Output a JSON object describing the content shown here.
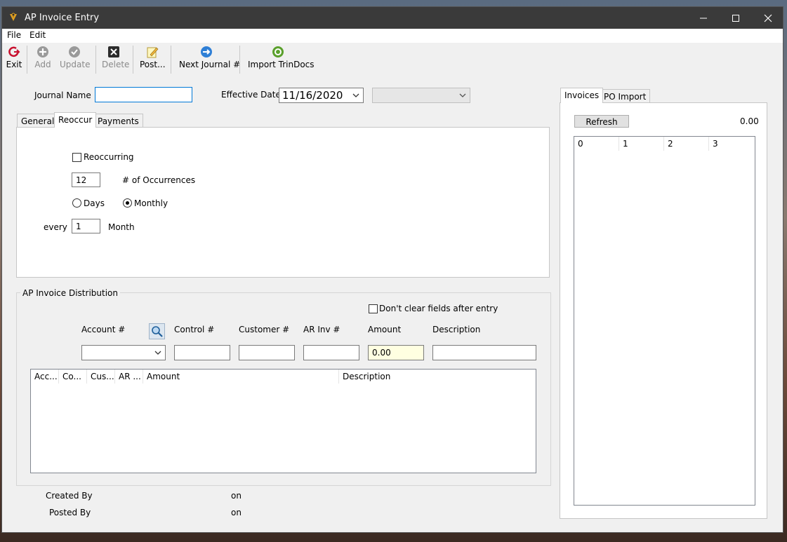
{
  "window": {
    "title": "AP Invoice Entry"
  },
  "menu": [
    "File",
    "Edit"
  ],
  "toolbar": {
    "exit": "Exit",
    "add": "Add",
    "update": "Update",
    "delete": "Delete",
    "post": "Post...",
    "next_journal": "Next Journal #",
    "import": "Import TrinDocs"
  },
  "header": {
    "journal_name_label": "Journal Name",
    "journal_name_value": "",
    "effective_date_label": "Effective Date",
    "effective_date_value": "11/16/2020"
  },
  "left_tabs": [
    "General",
    "Reoccur",
    "Payments"
  ],
  "reoccur": {
    "reoccurring_label": "Reoccurring",
    "occurrences_value": "12",
    "occurrences_label": "# of Occurrences",
    "days_label": "Days",
    "monthly_label": "Monthly",
    "every_label": "every",
    "every_value": "1",
    "unit_label": "Month"
  },
  "distribution": {
    "title": "AP Invoice Distribution",
    "dont_clear_label": "Don't clear fields after entry",
    "account_label": "Account #",
    "control_label": "Control #",
    "customer_label": "Customer #",
    "arinv_label": "AR Inv #",
    "amount_label": "Amount",
    "description_label": "Description",
    "amount_value": "0.00",
    "columns": [
      "Acc...",
      "Co...",
      "Cus...",
      "AR ...",
      "Amount",
      "Description"
    ]
  },
  "footer": {
    "created_by_label": "Created By",
    "posted_by_label": "Posted By",
    "on1": "on",
    "on2": "on"
  },
  "right_tabs": [
    "Invoices",
    "PO Import"
  ],
  "invoices": {
    "refresh_label": "Refresh",
    "total": "0.00",
    "columns": [
      "0",
      "1",
      "2",
      "3"
    ]
  },
  "colors": {
    "titlebar": "#3a3a3a",
    "focus": "#0078d7",
    "amount_bg": "#ffffe1"
  }
}
